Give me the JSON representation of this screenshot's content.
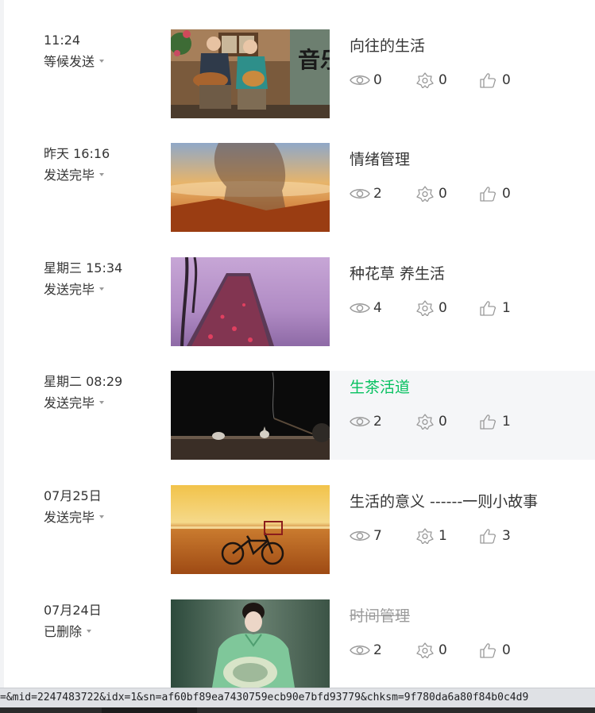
{
  "articles": [
    {
      "time": "11:24",
      "status": "等候发送",
      "title": "向往的生活",
      "views": "0",
      "shares": "0",
      "likes": "0"
    },
    {
      "time": "昨天 16:16",
      "status": "发送完毕",
      "title": "情绪管理",
      "views": "2",
      "shares": "0",
      "likes": "0"
    },
    {
      "time": "星期三 15:34",
      "status": "发送完毕",
      "title": "种花草 养生活",
      "views": "4",
      "shares": "0",
      "likes": "1"
    },
    {
      "time": "星期二 08:29",
      "status": "发送完毕",
      "title": "生茶活道",
      "views": "2",
      "shares": "0",
      "likes": "1"
    },
    {
      "time": "07月25日",
      "status": "发送完毕",
      "title": "生活的意义 ------一则小故事",
      "views": "7",
      "shares": "1",
      "likes": "3"
    },
    {
      "time": "07月24日",
      "status": "已删除",
      "title": "时间管理",
      "views": "2",
      "shares": "0",
      "likes": "0"
    }
  ],
  "status_bar_url": "=&mid=2247483722&idx=1&sn=af60bf89ea7430759ecb90e7bfd93779&chksm=9f780da6a80f84b0c4d9",
  "icons": {
    "views": "eye-icon",
    "shares": "share-icon",
    "likes": "thumbs-up-icon"
  },
  "colors": {
    "link": "#07c160",
    "text": "#353535",
    "muted": "#9a9a9a",
    "hover_bg": "#f5f6f8"
  }
}
